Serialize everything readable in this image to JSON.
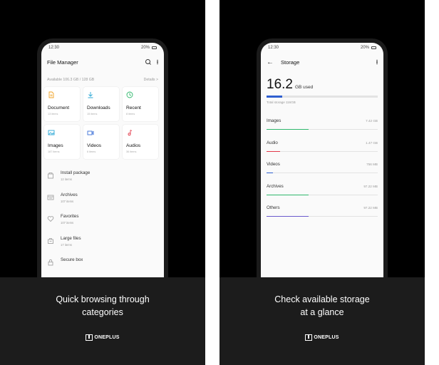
{
  "left": {
    "status": {
      "time": "12:30",
      "battery": "20%"
    },
    "appbar": {
      "title": "File Manager"
    },
    "available": {
      "text": "Available 106.3 GB / 128 GB",
      "details": "Details >"
    },
    "categories": [
      {
        "label": "Document",
        "sub": "13 items",
        "icon": "document-icon",
        "color": "#f0a020"
      },
      {
        "label": "Downloads",
        "sub": "15 items",
        "icon": "download-icon",
        "color": "#2aa7d6"
      },
      {
        "label": "Recent",
        "sub": "8 items",
        "icon": "clock-icon",
        "color": "#2fb86c"
      },
      {
        "label": "Images",
        "sub": "187 items",
        "icon": "image-icon",
        "color": "#2aa7d6"
      },
      {
        "label": "Videos",
        "sub": "6 items",
        "icon": "video-icon",
        "color": "#3a6fd8"
      },
      {
        "label": "Audios",
        "sub": "36 items",
        "icon": "music-note-icon",
        "color": "#e23a4a"
      }
    ],
    "list": [
      {
        "label": "Install package",
        "sub": "12 items",
        "icon": "package-icon"
      },
      {
        "label": "Archives",
        "sub": "107 items",
        "icon": "archive-icon"
      },
      {
        "label": "Favorites",
        "sub": "107 items",
        "icon": "heart-icon"
      },
      {
        "label": "Large files",
        "sub": "17 items",
        "icon": "large-files-icon"
      },
      {
        "label": "Secure box",
        "sub": "",
        "icon": "lock-icon"
      }
    ],
    "caption_line1": "Quick browsing through",
    "caption_line2": "categories"
  },
  "right": {
    "status": {
      "time": "12:30",
      "battery": "20%"
    },
    "appbar": {
      "title": "Storage"
    },
    "used": {
      "number": "16.2",
      "unit": "GB used",
      "fraction": 0.14
    },
    "total": "Total storage 116GB",
    "categories": [
      {
        "label": "Images",
        "size": "7.42 GB",
        "fraction": 0.38,
        "color": "#2fb86c"
      },
      {
        "label": "Audio",
        "size": "1.47 GB",
        "fraction": 0.12,
        "color": "#e23a4a"
      },
      {
        "label": "Videos",
        "size": "756 MB",
        "fraction": 0.06,
        "color": "#2f5fd0"
      },
      {
        "label": "Archives",
        "size": "97.22 MB",
        "fraction": 0.38,
        "color": "#2fb86c"
      },
      {
        "label": "Others",
        "size": "97.22 MB",
        "fraction": 0.38,
        "color": "#6a5acd"
      }
    ],
    "caption_line1": "Check available storage",
    "caption_line2": "at a glance"
  },
  "brand": {
    "name": "ONEPLUS"
  }
}
